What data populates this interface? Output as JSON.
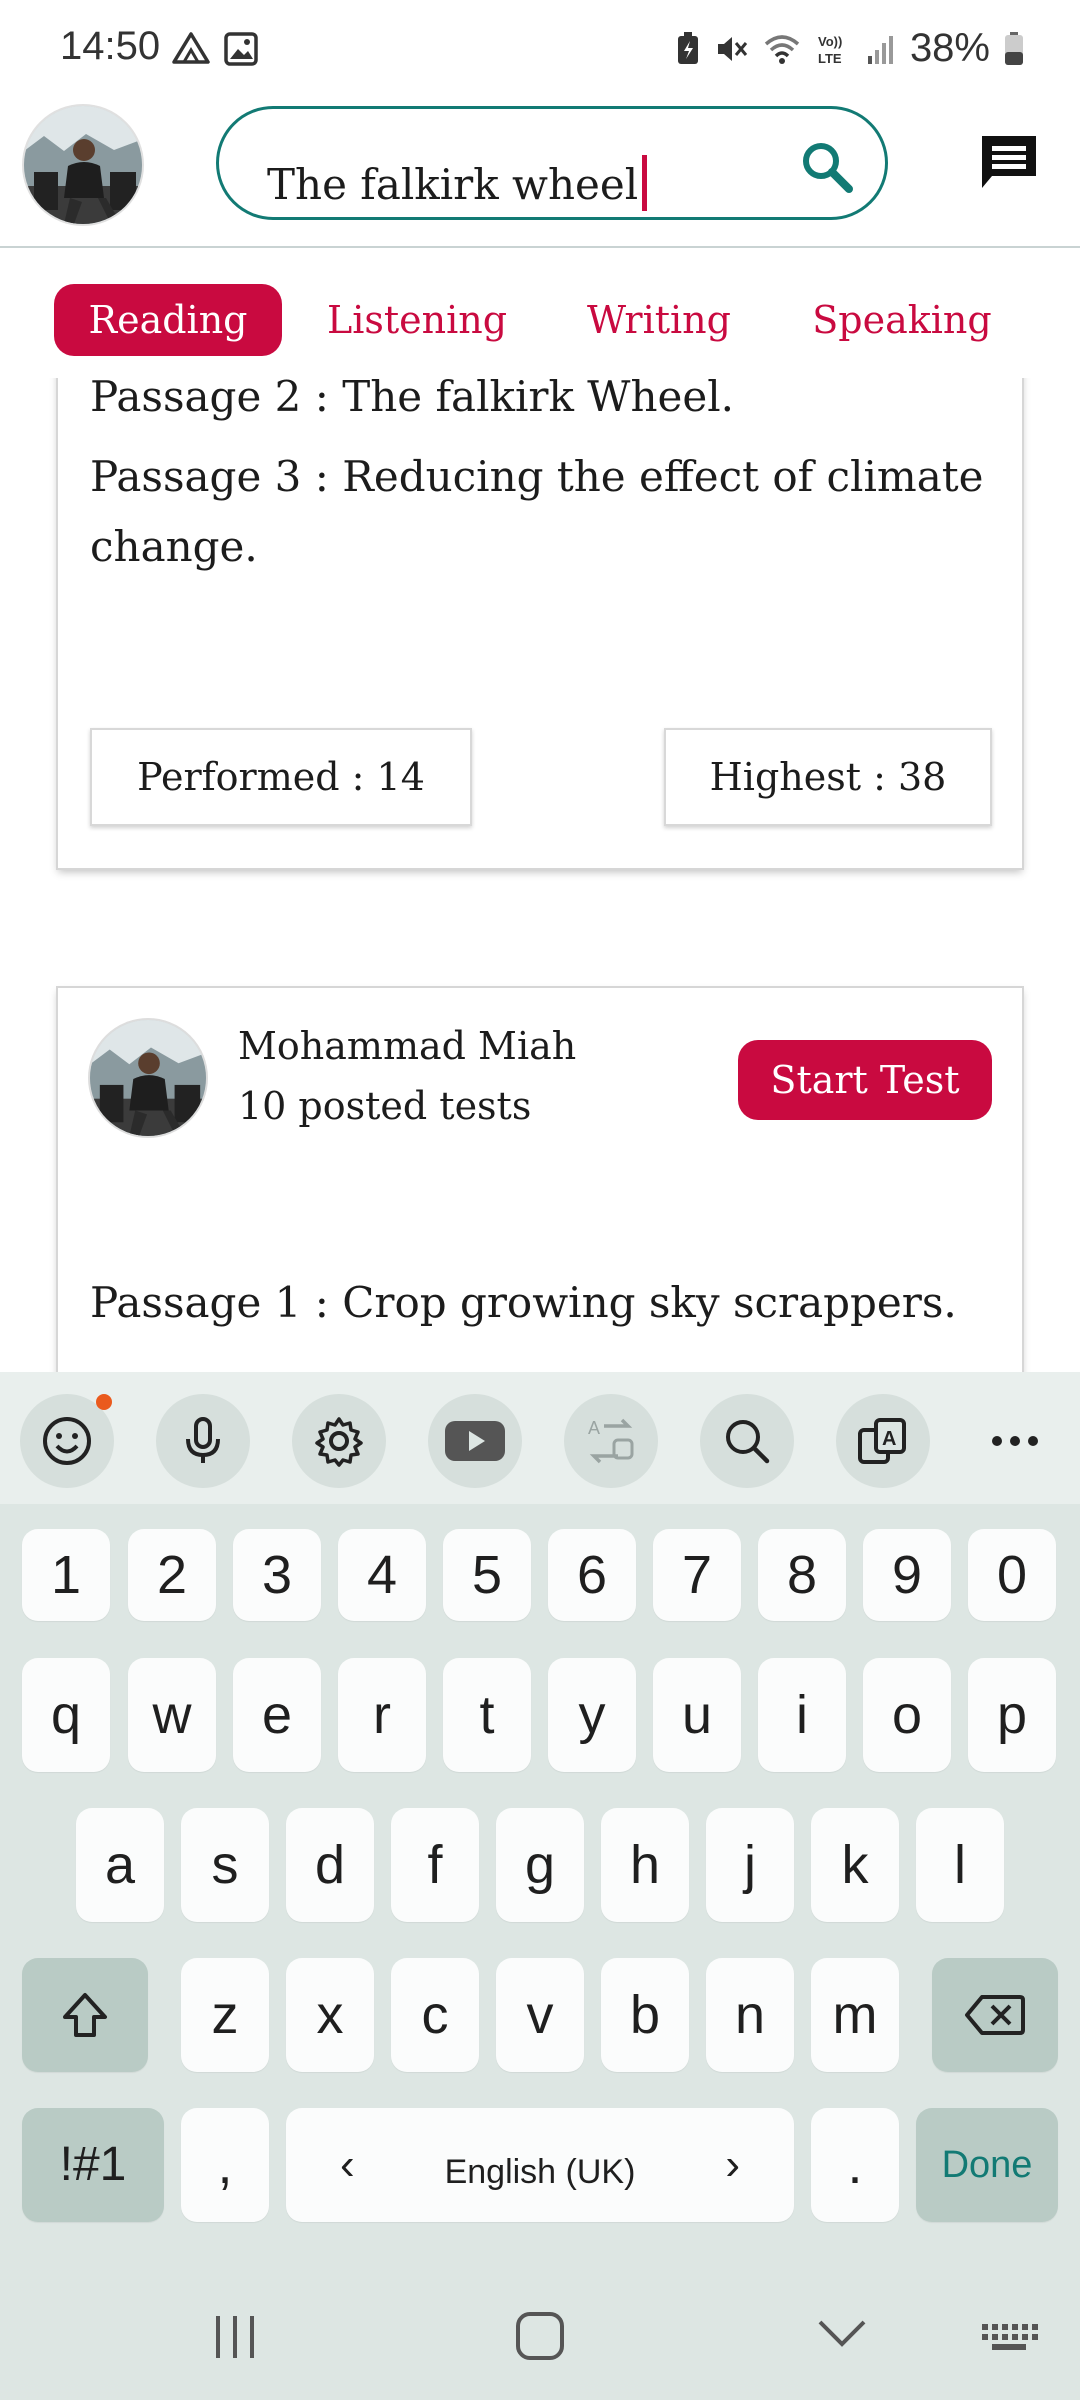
{
  "status_bar": {
    "time": "14:50",
    "battery_percent": "38%",
    "icons": [
      "drive-icon",
      "image-icon",
      "battery-saver-icon",
      "mute-icon",
      "wifi-calling-icon",
      "volte-icon",
      "signal-icon",
      "battery-icon"
    ]
  },
  "header": {
    "search_value": "The falkirk wheel",
    "search_icon": "search-icon",
    "chat_icon": "chat-icon"
  },
  "tabs": [
    {
      "label": "Reading",
      "active": true
    },
    {
      "label": "Listening",
      "active": false
    },
    {
      "label": "Writing",
      "active": false
    },
    {
      "label": "Speaking",
      "active": false
    }
  ],
  "cards": [
    {
      "passages": [
        "Passage 2 : The falkirk Wheel.",
        "Passage 3 : Reducing the effect of climate change."
      ],
      "performed": "Performed : 14",
      "highest": "Highest : 38"
    },
    {
      "author": "Mohammad Miah",
      "posted": "10 posted tests",
      "start_label": "Start Test",
      "passages": [
        "Passage 1 : Crop growing sky scrappers."
      ]
    }
  ],
  "keyboard": {
    "toolbar": [
      "emoji-icon",
      "microphone-icon",
      "settings-icon",
      "youtube-icon",
      "translate-icon",
      "search-icon",
      "text-extract-icon",
      "more-icon"
    ],
    "number_row": [
      "1",
      "2",
      "3",
      "4",
      "5",
      "6",
      "7",
      "8",
      "9",
      "0"
    ],
    "row1": [
      "q",
      "w",
      "e",
      "r",
      "t",
      "y",
      "u",
      "i",
      "o",
      "p"
    ],
    "row2": [
      "a",
      "s",
      "d",
      "f",
      "g",
      "h",
      "j",
      "k",
      "l"
    ],
    "row3": [
      "z",
      "x",
      "c",
      "v",
      "b",
      "n",
      "m"
    ],
    "symbols_label": "!#1",
    "comma": ",",
    "space_label": "English (UK)",
    "period": ".",
    "done_label": "Done",
    "accent_color": "#127a74"
  },
  "colors": {
    "brand": "#c90a40",
    "search_border": "#127a74"
  }
}
